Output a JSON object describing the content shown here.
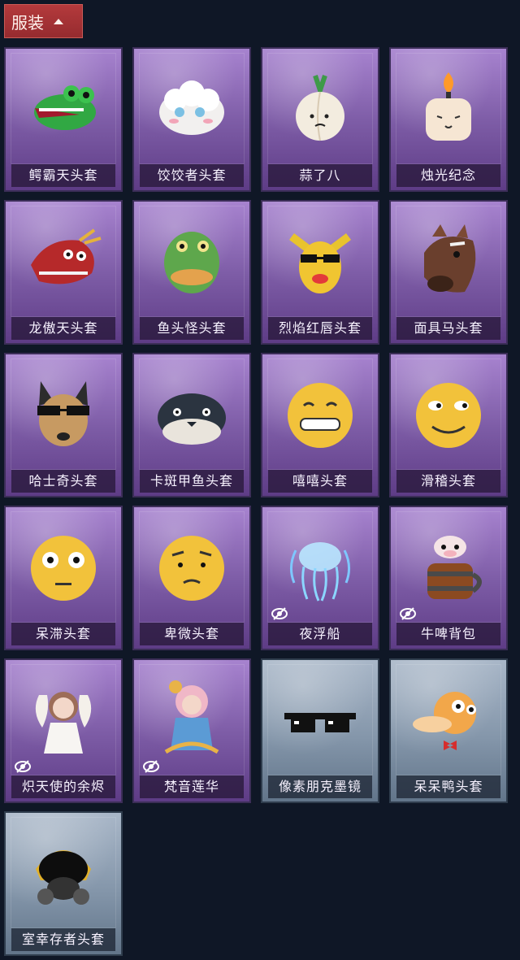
{
  "section": {
    "title": "服装"
  },
  "items": [
    {
      "name": "鳄霸天头套",
      "frame": "purple",
      "hidden": false,
      "icon": "crocodile-head-icon"
    },
    {
      "name": "饺饺者头套",
      "frame": "purple",
      "hidden": false,
      "icon": "dumpling-head-icon"
    },
    {
      "name": "蒜了八",
      "frame": "purple",
      "hidden": false,
      "icon": "garlic-head-icon"
    },
    {
      "name": "烛光纪念",
      "frame": "purple",
      "hidden": false,
      "icon": "candle-head-icon"
    },
    {
      "name": "龙傲天头套",
      "frame": "purple",
      "hidden": false,
      "icon": "dragon-head-icon"
    },
    {
      "name": "鱼头怪头套",
      "frame": "purple",
      "hidden": false,
      "icon": "fish-monster-head-icon"
    },
    {
      "name": "烈焰红唇头套",
      "frame": "purple",
      "hidden": false,
      "icon": "yellow-mask-head-icon"
    },
    {
      "name": "面具马头套",
      "frame": "purple",
      "hidden": false,
      "icon": "horse-head-icon"
    },
    {
      "name": "哈士奇头套",
      "frame": "purple",
      "hidden": false,
      "icon": "husky-head-icon"
    },
    {
      "name": "卡斑甲鱼头套",
      "frame": "purple",
      "hidden": false,
      "icon": "turtle-head-icon"
    },
    {
      "name": "嘻嘻头套",
      "frame": "purple",
      "hidden": false,
      "icon": "grin-emoji-head-icon"
    },
    {
      "name": "滑稽头套",
      "frame": "purple",
      "hidden": false,
      "icon": "smirk-emoji-head-icon"
    },
    {
      "name": "呆滞头套",
      "frame": "purple",
      "hidden": false,
      "icon": "stunned-emoji-head-icon"
    },
    {
      "name": "卑微头套",
      "frame": "purple",
      "hidden": false,
      "icon": "humble-emoji-head-icon"
    },
    {
      "name": "夜浮船",
      "frame": "purple",
      "hidden": true,
      "icon": "jellyfish-icon"
    },
    {
      "name": "牛啤背包",
      "frame": "purple",
      "hidden": true,
      "icon": "cow-beer-backpack-icon"
    },
    {
      "name": "炽天使的余烬",
      "frame": "purple",
      "hidden": true,
      "icon": "angel-figure-icon"
    },
    {
      "name": "梵音莲华",
      "frame": "purple",
      "hidden": true,
      "icon": "lotus-figure-icon"
    },
    {
      "name": "像素朋克墨镜",
      "frame": "gray",
      "hidden": false,
      "icon": "pixel-sunglasses-icon"
    },
    {
      "name": "呆呆鸭头套",
      "frame": "gray",
      "hidden": false,
      "icon": "duck-head-icon"
    },
    {
      "name": "室幸存者头套",
      "frame": "gray",
      "hidden": false,
      "icon": "gas-mask-helmet-icon"
    }
  ]
}
